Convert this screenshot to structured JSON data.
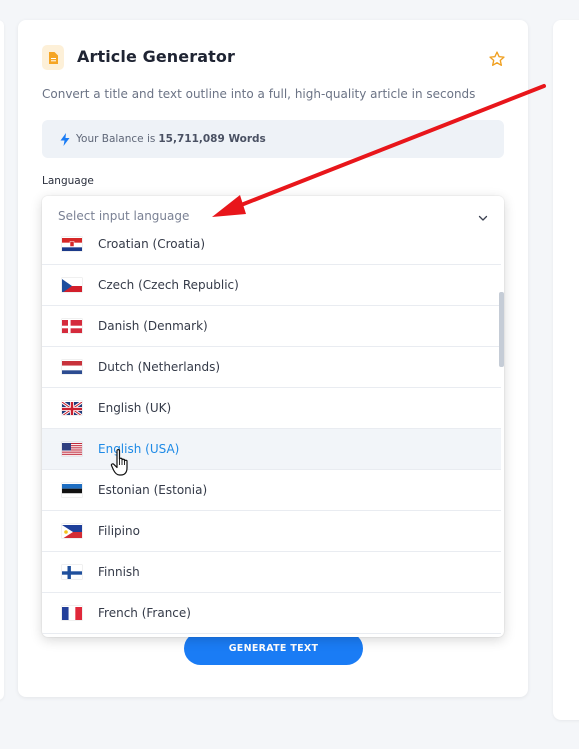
{
  "app": {
    "title": "Article Generator",
    "subtitle": "Convert a title and text outline into a full, high-quality article in seconds",
    "icon": "document-icon",
    "accent": "#1a7cf5"
  },
  "balance": {
    "prefix": "Your Balance is",
    "value": "15,711,089 Words",
    "icon": "bolt-icon"
  },
  "form": {
    "language_label": "Language",
    "language_placeholder": "Select input language",
    "generate_label": "GENERATE TEXT"
  },
  "languages": [
    {
      "label": "Croatian (Croatia)",
      "flag": "croatia-flag-icon"
    },
    {
      "label": "Czech (Czech Republic)",
      "flag": "czech-flag-icon"
    },
    {
      "label": "Danish (Denmark)",
      "flag": "denmark-flag-icon"
    },
    {
      "label": "Dutch (Netherlands)",
      "flag": "netherlands-flag-icon"
    },
    {
      "label": "English (UK)",
      "flag": "uk-flag-icon"
    },
    {
      "label": "English (USA)",
      "flag": "usa-flag-icon",
      "hovered": true
    },
    {
      "label": "Estonian (Estonia)",
      "flag": "estonia-flag-icon"
    },
    {
      "label": "Filipino",
      "flag": "philippines-flag-icon"
    },
    {
      "label": "Finnish",
      "flag": "finland-flag-icon"
    },
    {
      "label": "French (France)",
      "flag": "france-flag-icon"
    }
  ],
  "colors": {
    "hover_text": "#1e8ae6",
    "star": "#f0a020",
    "annotation_arrow": "#e8161b"
  }
}
